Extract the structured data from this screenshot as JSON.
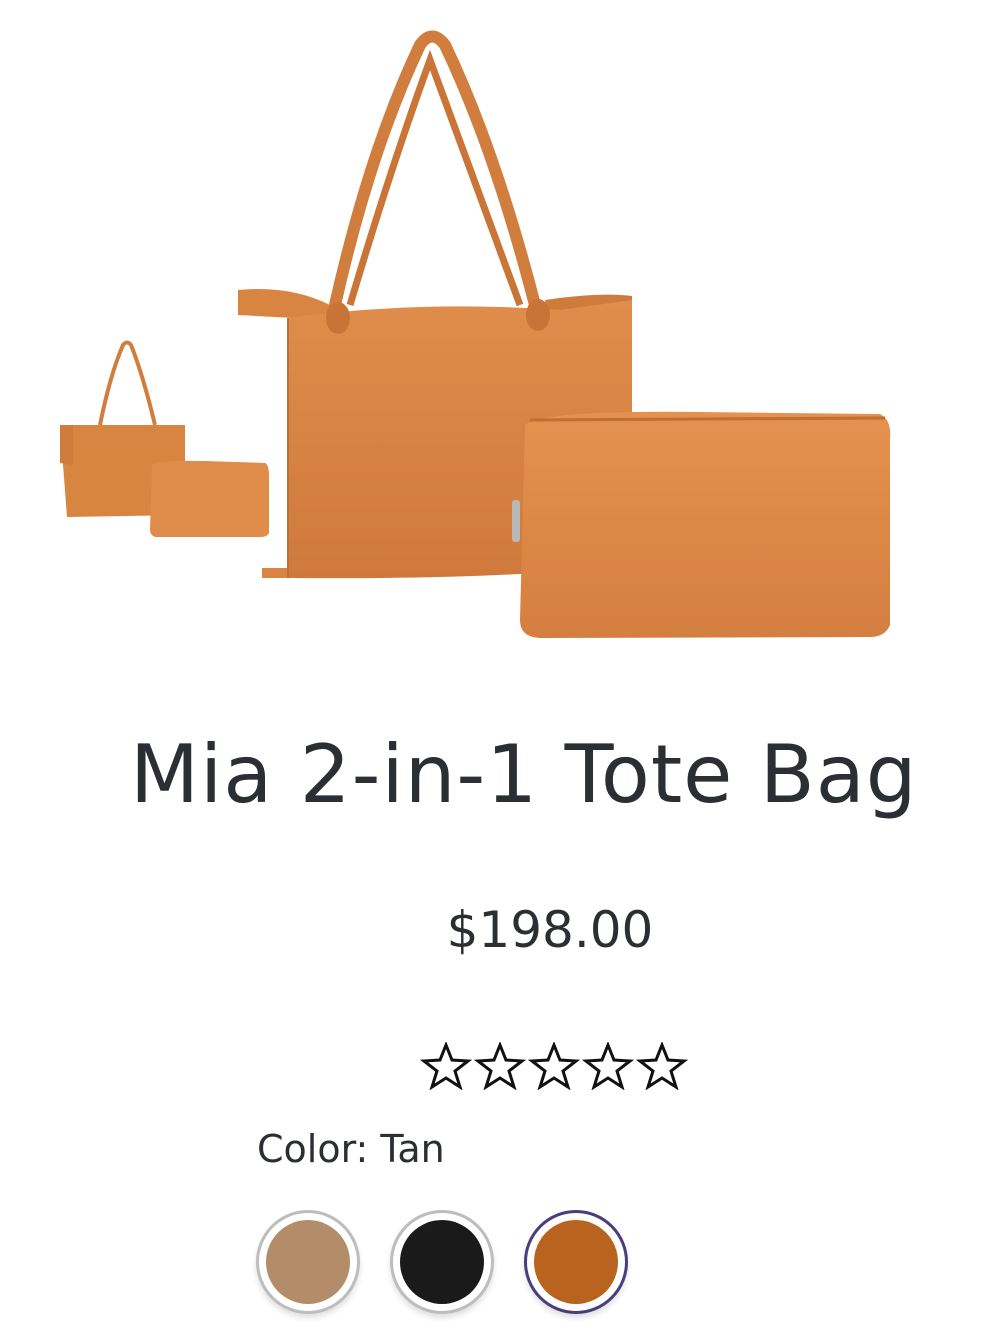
{
  "product": {
    "name": "Mia 2-in-1 Tote Bag",
    "price": "$198.00",
    "rating": {
      "value": 0,
      "max": 5,
      "icon": "star-outline-icon"
    },
    "color_label": "Color: Tan",
    "swatches": [
      {
        "name": "tan",
        "color": "#b38d69",
        "selected": false
      },
      {
        "name": "black",
        "color": "#1a1a1a",
        "selected": false
      },
      {
        "name": "cognac",
        "color": "#b8641f",
        "selected": true
      }
    ]
  },
  "colors": {
    "leather": "#d98441",
    "leather_shade": "#c06f31",
    "text": "#2b2f33",
    "selected_ring": "#4a3d7a"
  }
}
